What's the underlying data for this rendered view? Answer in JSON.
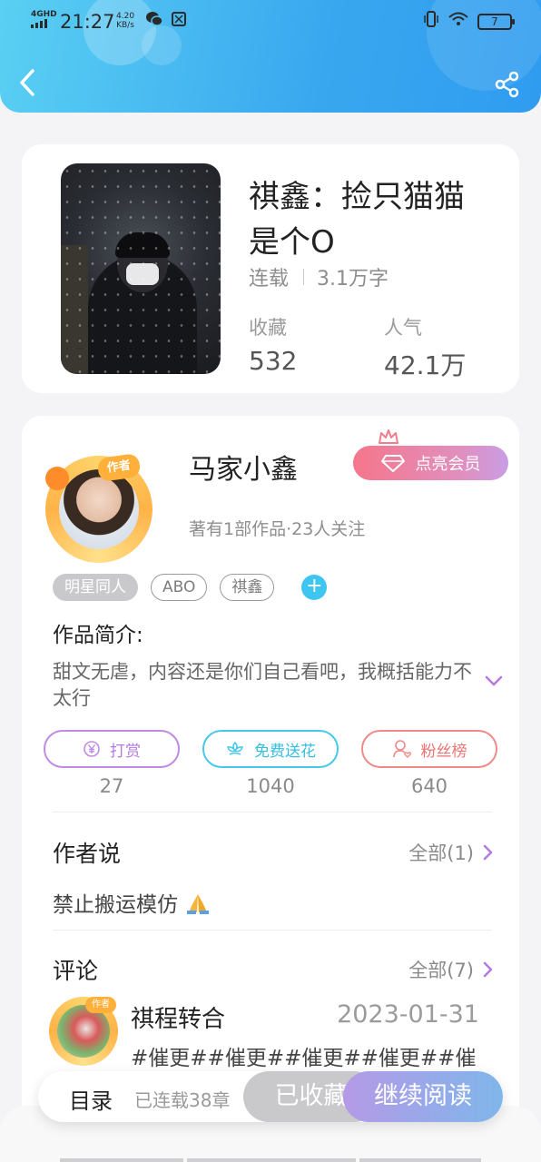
{
  "status_bar": {
    "network": "4GHD",
    "time": "21:27",
    "speed_value": "4.20",
    "speed_unit": "KB/s",
    "battery": "7"
  },
  "book": {
    "title": "祺鑫：捡只猫猫是个O",
    "status": "连载",
    "word_count": "3.1万字",
    "favorites_label": "收藏",
    "favorites_value": "532",
    "popularity_label": "人气",
    "popularity_value": "42.1万"
  },
  "author": {
    "name": "马家小鑫",
    "badge": "作者",
    "meta": "著有1部作品·23人关注",
    "vip_button": "点亮会员"
  },
  "tags": [
    "明星同人",
    "ABO",
    "祺鑫"
  ],
  "intro": {
    "label": "作品简介:",
    "text": "甜文无虐，内容还是你们自己看吧，我概括能力不太行"
  },
  "actions": [
    {
      "label": "打赏",
      "count": "27",
      "color": "#c08be6",
      "icon": "yen-coin-icon"
    },
    {
      "label": "免费送花",
      "count": "1040",
      "color": "#45c9ea",
      "icon": "flower-icon"
    },
    {
      "label": "粉丝榜",
      "count": "640",
      "color": "#ef8a8a",
      "icon": "fan-user-icon"
    }
  ],
  "author_says": {
    "title": "作者说",
    "more": "全部(1)",
    "text": "禁止搬运模仿"
  },
  "comments": {
    "title": "评论",
    "more": "全部(7)",
    "items": [
      {
        "user": "祺程转合",
        "badge": "作者",
        "date": "2023-01-31",
        "text": "#催更##催更##催更##催更##催更"
      }
    ]
  },
  "bottom_bar": {
    "catalog": "目录",
    "progress": "已连载38章",
    "favorited": "已收藏",
    "continue": "继续阅读"
  },
  "colors": {
    "header_start": "#5ad0f3",
    "header_end": "#2f9cf0",
    "accent_purple": "#b37ae0",
    "vip_pink": "#f5768a"
  }
}
